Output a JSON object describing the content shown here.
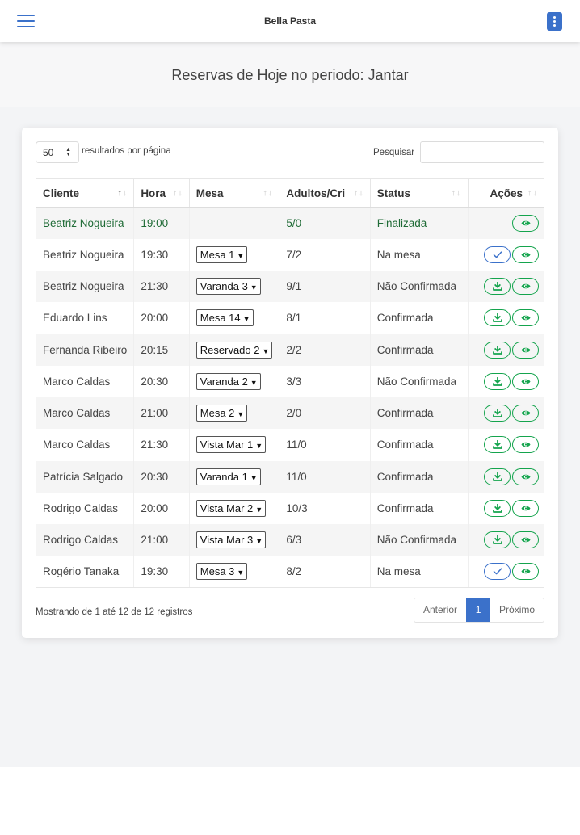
{
  "app": {
    "brand": "Bella Pasta",
    "menu_icon": "hamburger-menu-icon",
    "kebab_icon": "vertical-dots-icon"
  },
  "page": {
    "title": "Reservas de Hoje no periodo: Jantar"
  },
  "controls": {
    "per_page_value": "50",
    "per_page_label": "resultados por página",
    "search_label": "Pesquisar",
    "search_value": ""
  },
  "table": {
    "headers": {
      "cliente": "Cliente",
      "hora": "Hora",
      "mesa": "Mesa",
      "adultos": "Adultos/Cri",
      "status": "Status",
      "acoes": "Ações"
    },
    "rows": [
      {
        "cliente": "Beatriz Nogueira",
        "hora": "19:00",
        "mesa": "",
        "adultos": "5/0",
        "status": "Finalizada"
      },
      {
        "cliente": "Beatriz Nogueira",
        "hora": "19:30",
        "mesa": "Mesa 1",
        "adultos": "7/2",
        "status": "Na mesa"
      },
      {
        "cliente": "Beatriz Nogueira",
        "hora": "21:30",
        "mesa": "Varanda 3",
        "adultos": "9/1",
        "status": "Não Confirmada"
      },
      {
        "cliente": "Eduardo Lins",
        "hora": "20:00",
        "mesa": "Mesa 14",
        "adultos": "8/1",
        "status": "Confirmada"
      },
      {
        "cliente": "Fernanda Ribeiro",
        "hora": "20:15",
        "mesa": "Reservado 2",
        "adultos": "2/2",
        "status": "Confirmada"
      },
      {
        "cliente": "Marco Caldas",
        "hora": "20:30",
        "mesa": "Varanda 2",
        "adultos": "3/3",
        "status": "Não Confirmada"
      },
      {
        "cliente": "Marco Caldas",
        "hora": "21:00",
        "mesa": "Mesa 2",
        "adultos": "2/0",
        "status": "Confirmada"
      },
      {
        "cliente": "Marco Caldas",
        "hora": "21:30",
        "mesa": "Vista Mar 1",
        "adultos": "11/0",
        "status": "Confirmada"
      },
      {
        "cliente": "Patrícia Salgado",
        "hora": "20:30",
        "mesa": "Varanda 1",
        "adultos": "11/0",
        "status": "Confirmada"
      },
      {
        "cliente": "Rodrigo Caldas",
        "hora": "20:00",
        "mesa": "Vista Mar 2",
        "adultos": "10/3",
        "status": "Confirmada"
      },
      {
        "cliente": "Rodrigo Caldas",
        "hora": "21:00",
        "mesa": "Vista Mar 3",
        "adultos": "6/3",
        "status": "Não Confirmada"
      },
      {
        "cliente": "Rogério Tanaka",
        "hora": "19:30",
        "mesa": "Mesa 3",
        "adultos": "8/2",
        "status": "Na mesa"
      }
    ]
  },
  "footer": {
    "info": "Mostrando de 1 até 12 de 12 registros",
    "prev": "Anterior",
    "page": "1",
    "next": "Próximo"
  },
  "colors": {
    "primary": "#3b71ca",
    "success": "#14a44d",
    "finalized_text": "#1f6b36"
  }
}
